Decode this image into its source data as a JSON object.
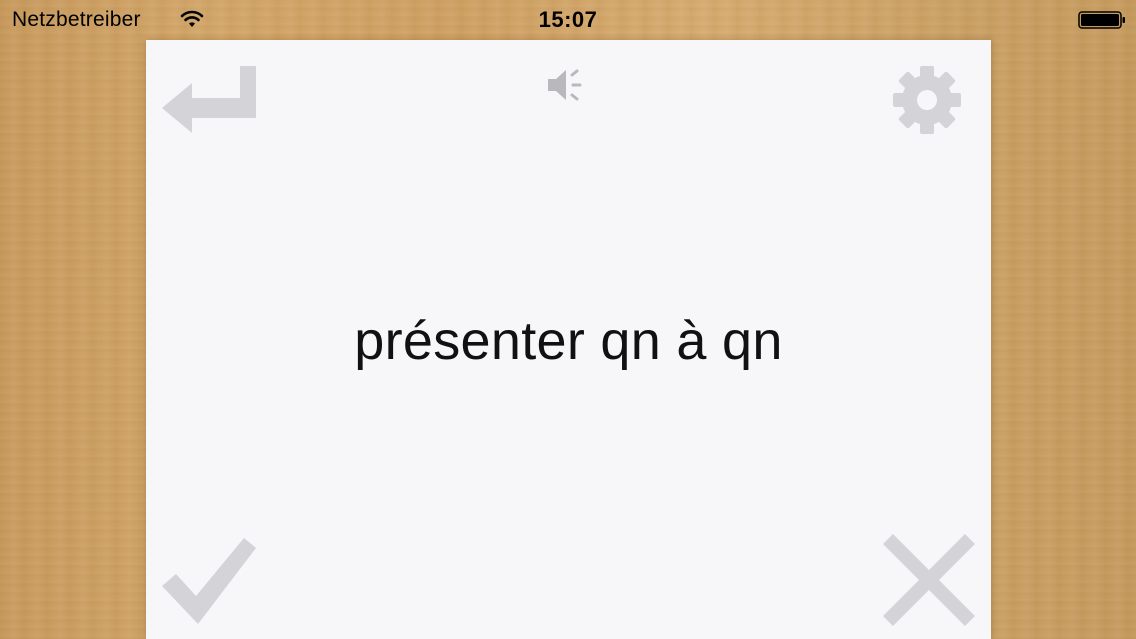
{
  "status_bar": {
    "carrier": "Netzbetreiber",
    "time": "15:07",
    "wifi_icon": "wifi-icon",
    "battery_icon": "battery-icon"
  },
  "card": {
    "term": "présenter qn à qn",
    "icons": {
      "back": "return-arrow-icon",
      "sound": "speaker-icon",
      "settings": "gear-icon",
      "correct": "checkmark-icon",
      "wrong": "cross-icon"
    }
  },
  "colors": {
    "card_background": "#f7f7f9",
    "icon_gray": "#cfcfd3",
    "wood": "#d0a266"
  }
}
